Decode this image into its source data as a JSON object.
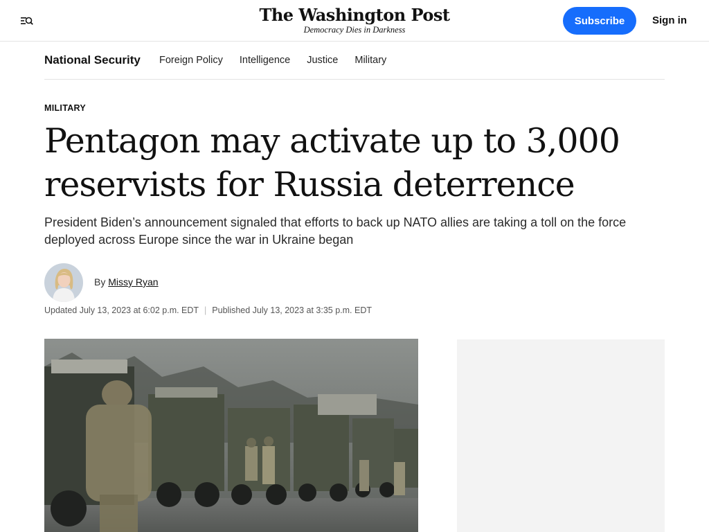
{
  "header": {
    "menu_icon": "menu-search-icon",
    "logo_name": "The Washington Post",
    "logo_tagline": "Democracy Dies in Darkness",
    "subscribe_label": "Subscribe",
    "signin_label": "Sign in",
    "accent_color": "#166dfc"
  },
  "section_nav": {
    "title": "National Security",
    "links": [
      "Foreign Policy",
      "Intelligence",
      "Justice",
      "Military"
    ]
  },
  "article": {
    "kicker": "MILITARY",
    "headline": "Pentagon may activate up to 3,000 reservists for Russia deterrence",
    "dek": "President Biden’s announcement signaled that efforts to back up NATO allies are taking a toll on the force deployed across Europe since the war in Ukraine began",
    "byline_prefix": "By",
    "author": "Missy Ryan",
    "updated": "Updated July 13, 2023 at 6:02 p.m. EDT",
    "published": "Published July 13, 2023 at 3:35 p.m. EDT"
  }
}
